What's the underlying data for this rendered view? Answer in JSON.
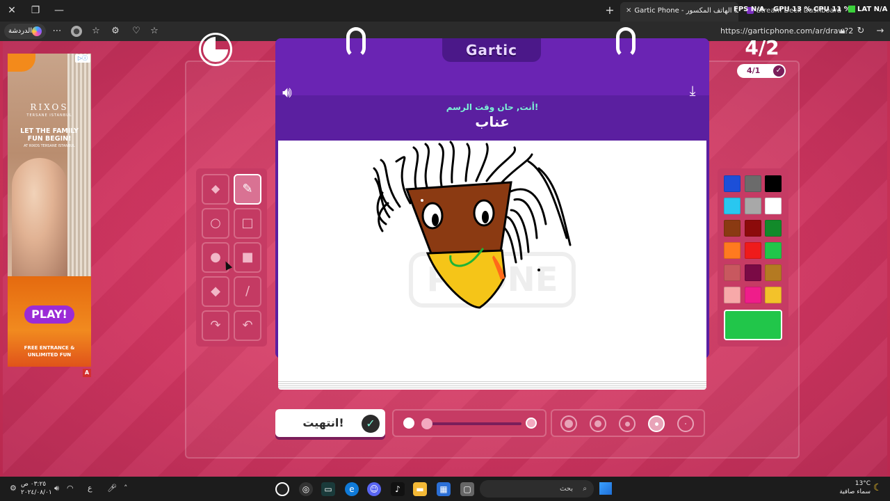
{
  "browser": {
    "tabs": [
      {
        "title": "Gartic Phone - لعبة الهاتف المكسور",
        "active": true
      },
      {
        "title": "Stream Deck Dashboard",
        "active": false
      }
    ],
    "hud": {
      "fps_label": "FPS",
      "fps_value": "N/A",
      "gpu_label": "GPU",
      "gpu_value": "13 %",
      "cpu_label": "CPU",
      "cpu_value": "11 %",
      "lat_label": "LAT",
      "lat_value": "N/A"
    },
    "chat_label": "الدردشة",
    "url": "https://garticphone.com/ar/draw?2"
  },
  "ad": {
    "brand": "RIXOS",
    "brand_sub": "TERSANE ISTANBUL",
    "headline": "LET THE FAMILY FUN BEGIN!",
    "subline": "AT RIXOS TERSANE ISTANBUL",
    "play_logo": "PLAY!",
    "footer": "FREE ENTRANCE & UNLIMITED FUN",
    "choices_mark": "▷ⓘ",
    "badge": "A"
  },
  "game": {
    "logo": "Gartic",
    "prompt": "أنت, حان وقت الرسم!",
    "word": "عناب",
    "round": "4/2",
    "sub_round": "4/1",
    "done_label": "انتهيت!",
    "watermark": "PHONE",
    "timer_remaining_fraction": 0.25,
    "opacity_fraction": 0.0
  },
  "tools": [
    {
      "name": "eraser-tool",
      "icon": "⬥",
      "selected": false
    },
    {
      "name": "pencil-tool",
      "icon": "✎",
      "selected": true
    },
    {
      "name": "ellipse-outline-tool",
      "icon": "○",
      "selected": false
    },
    {
      "name": "rectangle-outline-tool",
      "icon": "□",
      "selected": false
    },
    {
      "name": "ellipse-filled-tool",
      "icon": "●",
      "selected": false
    },
    {
      "name": "rectangle-filled-tool",
      "icon": "■",
      "selected": false
    },
    {
      "name": "fill-bucket-tool",
      "icon": "◆",
      "selected": false
    },
    {
      "name": "line-tool",
      "icon": "∕",
      "selected": false
    },
    {
      "name": "redo-tool",
      "icon": "↷",
      "selected": false
    },
    {
      "name": "undo-tool",
      "icon": "↶",
      "selected": false
    }
  ],
  "palette": [
    "#1c4fd8",
    "#6b6b6b",
    "#000000",
    "#29c7f0",
    "#a8a8a8",
    "#ffffff",
    "#8a3a12",
    "#8c0b0b",
    "#128a2a",
    "#ff7a1f",
    "#ef1b1b",
    "#21c64a",
    "#c8585f",
    "#7a0a45",
    "#b47a22",
    "#f7a9a9",
    "#ef1d8a",
    "#f3c22a"
  ],
  "current_color": "#21c64a",
  "brush_sizes": [
    {
      "name": "brush-size-xl",
      "selected": false
    },
    {
      "name": "brush-size-lg",
      "selected": false
    },
    {
      "name": "brush-size-md",
      "selected": false
    },
    {
      "name": "brush-size-sm",
      "selected": true
    },
    {
      "name": "brush-size-xs",
      "selected": false
    }
  ],
  "taskbar": {
    "search_placeholder": "بحث",
    "weather_temp": "13°C",
    "weather_desc": "سماء صافية",
    "time": "٠٣:٢٥ ص",
    "date": "٢٠٢٤/٠٨/٠١",
    "lang": "ع"
  }
}
